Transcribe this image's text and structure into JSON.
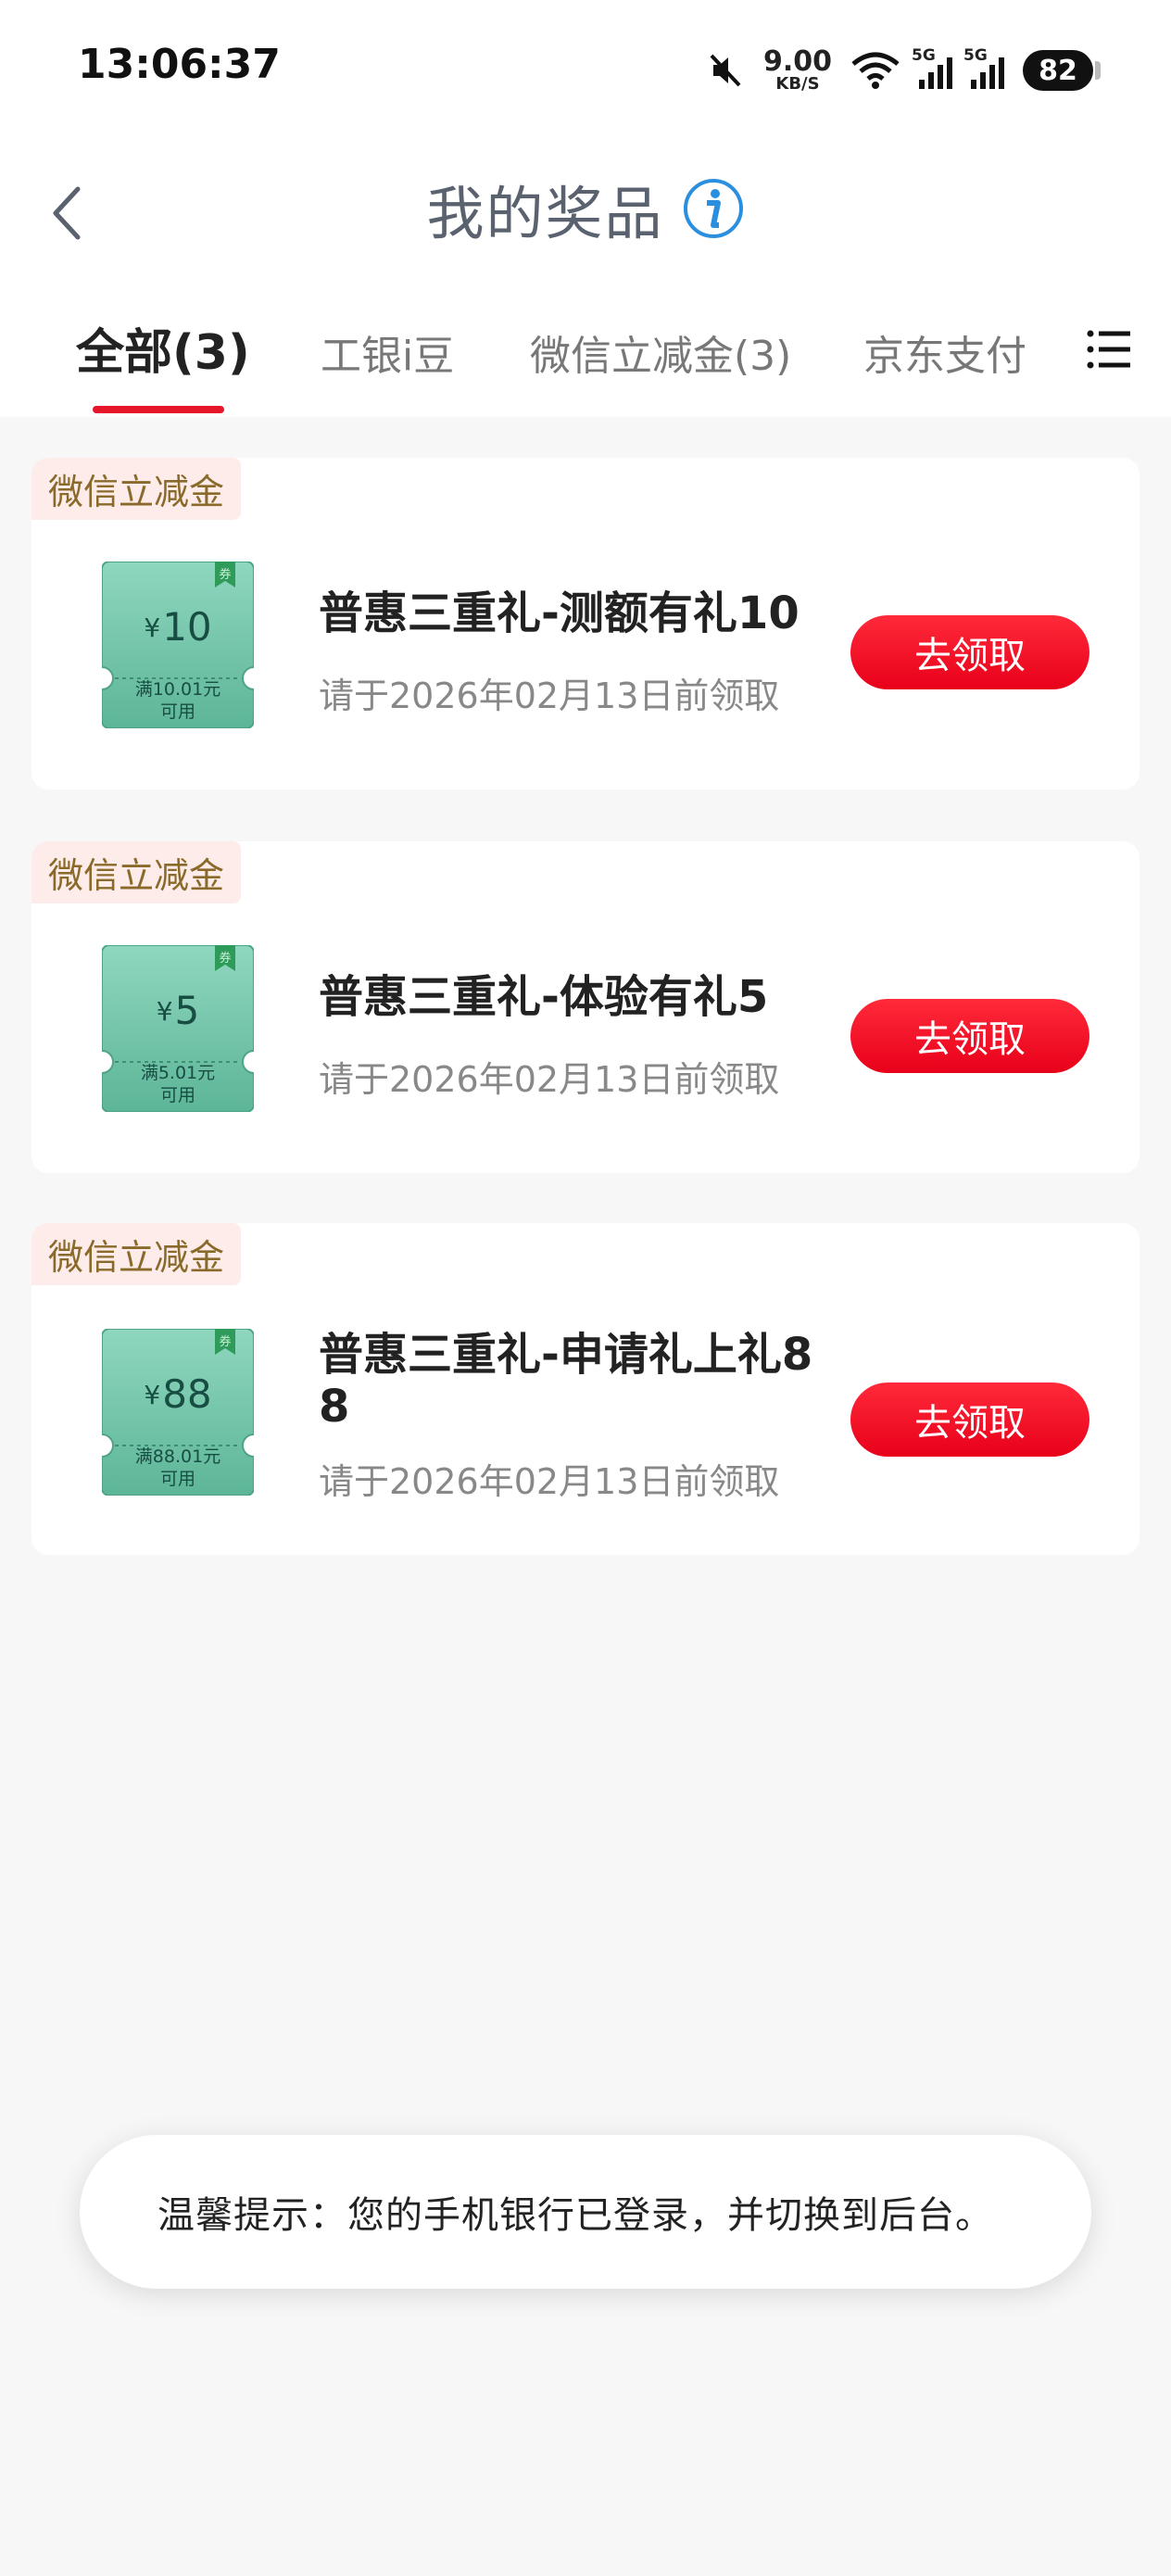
{
  "status_bar": {
    "time": "13:06:37",
    "net_speed_value": "9.00",
    "net_speed_unit": "KB/S",
    "signal1_label": "5G",
    "signal2_label": "5G",
    "battery": "82"
  },
  "header": {
    "title": "我的奖品"
  },
  "tabs": [
    {
      "label": "全部(3)",
      "active": true
    },
    {
      "label": "工银i豆"
    },
    {
      "label": "微信立减金(3)"
    },
    {
      "label": "京东支付"
    }
  ],
  "prizes": [
    {
      "tag": "微信立减金",
      "yen": "¥",
      "amount": "10",
      "cond_line1": "满10.01元",
      "cond_line2": "可用",
      "name": "普惠三重礼-测额有礼10",
      "deadline": "请于2026年02月13日前领取",
      "button": "去领取"
    },
    {
      "tag": "微信立减金",
      "yen": "¥",
      "amount": "5",
      "cond_line1": "满5.01元",
      "cond_line2": "可用",
      "name": "普惠三重礼-体验有礼5",
      "deadline": "请于2026年02月13日前领取",
      "button": "去领取"
    },
    {
      "tag": "微信立减金",
      "yen": "¥",
      "amount": "88",
      "cond_line1": "满88.01元",
      "cond_line2": "可用",
      "name": "普惠三重礼-申请礼上礼88",
      "deadline": "请于2026年02月13日前领取",
      "button": "去领取"
    }
  ],
  "toast": {
    "text": "温馨提示：您的手机银行已登录，并切换到后台。"
  },
  "colors": {
    "accent_red": "#e5162a",
    "coupon_green": "#6cc3a8",
    "tag_bg": "#fdecea"
  }
}
